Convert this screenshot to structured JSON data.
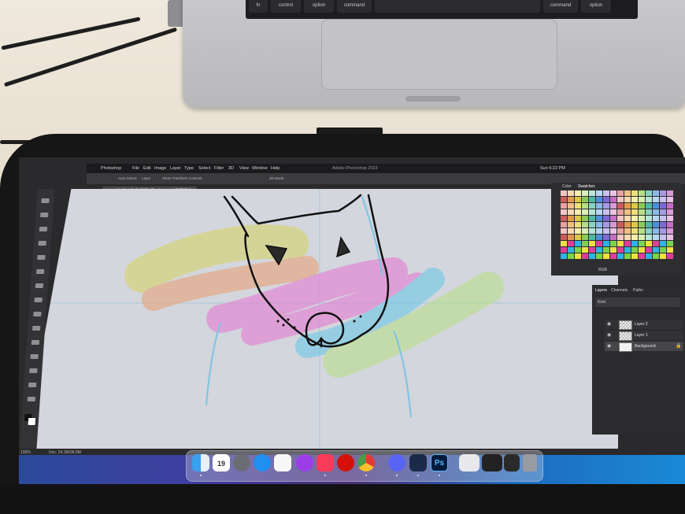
{
  "app": {
    "name": "Photoshop",
    "window_title": "Adobe Photoshop 2023",
    "menu": [
      "Photoshop",
      "File",
      "Edit",
      "Image",
      "Layer",
      "Type",
      "Select",
      "Filter",
      "3D",
      "View",
      "Window",
      "Help"
    ],
    "clock": "Sun 6:22 PM"
  },
  "document": {
    "tab_title": "Untitled-2 @ 100% (Background, RGB/8) *",
    "zoom": "100%",
    "doc_size": "Doc: 24.1M/36.0M"
  },
  "options_bar": {
    "items": [
      "Auto-Select:",
      "Layer",
      "Show Transform Controls",
      "3D Mode:"
    ]
  },
  "panels": {
    "swatches_tabs": [
      "Color",
      "Swatches"
    ],
    "swatch_group": "RGB",
    "layers_tabs": [
      "Layers",
      "Channels",
      "Paths"
    ],
    "blend_kind": "Kind",
    "layers": [
      {
        "name": "Layer 2"
      },
      {
        "name": "Layer 1"
      },
      {
        "name": "Background"
      }
    ]
  },
  "dock": {
    "calendar_day": "19",
    "icons": [
      "finder-icon",
      "calendar-icon",
      "rocket-icon",
      "safari-icon",
      "messages-icon",
      "notes-icon",
      "podcasts-icon",
      "music-icon",
      "lastfm-icon",
      "chrome-icon",
      "discord-icon",
      "xcode-icon",
      "photoshop-icon",
      "trash-icon"
    ],
    "ps_label": "Ps"
  },
  "keyboard": {
    "keys": [
      "fn",
      "control",
      "option",
      "command",
      "command",
      "option"
    ]
  },
  "colors": {
    "canvas": "#d3d6dc",
    "ps_dark": "#2a2a2c",
    "stroke_yellow": "#d6d46a",
    "stroke_orange": "#e8a277",
    "stroke_pink": "#e57bd3",
    "stroke_blue": "#6fc8e6",
    "stroke_green": "#b9df8c"
  }
}
